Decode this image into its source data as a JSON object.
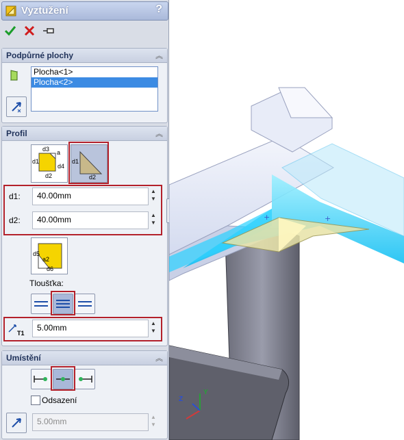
{
  "window": {
    "title": "Vyztužení",
    "help": "?"
  },
  "toolbar": {
    "ok_icon": "checkmark-icon",
    "cancel_icon": "x-icon",
    "pin_icon": "pushpin-icon"
  },
  "support_faces": {
    "title": "Podpůrné plochy",
    "items": [
      "Plocha<1>",
      "Plocha<2>"
    ],
    "selected_index": 1
  },
  "profile": {
    "title": "Profil",
    "d1_label": "d1:",
    "d1_value": "40.00mm",
    "d2_label": "d2:",
    "d2_value": "40.00mm",
    "thickness_label": "Tloušťka:",
    "thickness_value": "5.00mm",
    "thickness_symbol": "T1",
    "profile_a_labels": {
      "d3": "d3",
      "a": "a",
      "d1": "d1",
      "d4": "d4",
      "d2": "d2"
    },
    "profile_b_labels": {
      "d1": "d1",
      "d2": "d2"
    },
    "chamfer_labels": {
      "d5": "d5",
      "a2": "a2",
      "d6": "d6"
    }
  },
  "placement": {
    "title": "Umístění",
    "offset_label": "Odsazení",
    "offset_checked": false,
    "offset_value": "5.00mm"
  },
  "colors": {
    "highlight_red": "#b3202a",
    "selection_blue": "#3c8be3",
    "tube_blue": "#dfe5f6",
    "glow": "#14c8ff",
    "gusset": "#e8e3a8"
  },
  "triad": {
    "z_label": "Z",
    "y_label": "Y"
  }
}
